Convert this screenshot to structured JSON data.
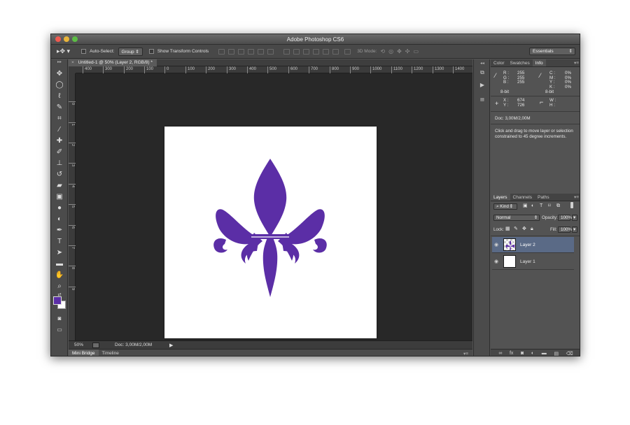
{
  "app": {
    "title": "Adobe Photoshop CS6"
  },
  "options_bar": {
    "auto_select_label": "Auto-Select:",
    "auto_select_value": "Group",
    "show_transform_label": "Show Transform Controls",
    "mode_3d_label": "3D Mode:",
    "workspace": "Essentials"
  },
  "document": {
    "tab_label": "Untitled-1 @ 50% (Layer 2, RGB/8) *",
    "ruler_h": [
      "400",
      "300",
      "200",
      "100",
      "0",
      "100",
      "200",
      "300",
      "400",
      "500",
      "600",
      "700",
      "800",
      "900",
      "1000",
      "1100",
      "1200",
      "1300",
      "1400"
    ],
    "ruler_v": [
      "0",
      "1",
      "2",
      "3",
      "4",
      "5",
      "6",
      "7",
      "8",
      "9"
    ],
    "logo_color": "#5b2ea6"
  },
  "status": {
    "zoom": "50%",
    "doc_size": "Doc: 3,00M/2,00M"
  },
  "bottom_tabs": [
    "Mini Bridge",
    "Timeline"
  ],
  "info_panel": {
    "tabs": [
      "Color",
      "Swatches",
      "Info"
    ],
    "rgb_labels": [
      "R :",
      "G :",
      "B :"
    ],
    "rgb_values": [
      "255",
      "255",
      "255"
    ],
    "cmyk_labels": [
      "C :",
      "M :",
      "Y :",
      "K :"
    ],
    "cmyk_values": [
      "0%",
      "0%",
      "0%",
      "0%"
    ],
    "bit_left": "8-bit",
    "bit_right": "8-bit",
    "x_label": "X :",
    "x_value": "674",
    "y_label": "Y :",
    "y_value": "726",
    "w_label": "W :",
    "h_label": "H :",
    "doc_size": "Doc: 3,00M/2,00M",
    "hint": "Click and drag to move layer or selection constrained to 45 degree increments."
  },
  "layers_panel": {
    "tabs": [
      "Layers",
      "Channels",
      "Paths"
    ],
    "filter_label": "Kind",
    "blend_mode": "Normal",
    "opacity_label": "Opacity:",
    "opacity_value": "100%",
    "lock_label": "Lock:",
    "fill_label": "Fill:",
    "fill_value": "100%",
    "layers": [
      {
        "name": "Layer 2",
        "selected": true
      },
      {
        "name": "Layer 1",
        "selected": false
      }
    ]
  },
  "colors": {
    "foreground": "#5b2ea6",
    "background": "#ffffff",
    "selected_layer": "#5a6a86"
  }
}
